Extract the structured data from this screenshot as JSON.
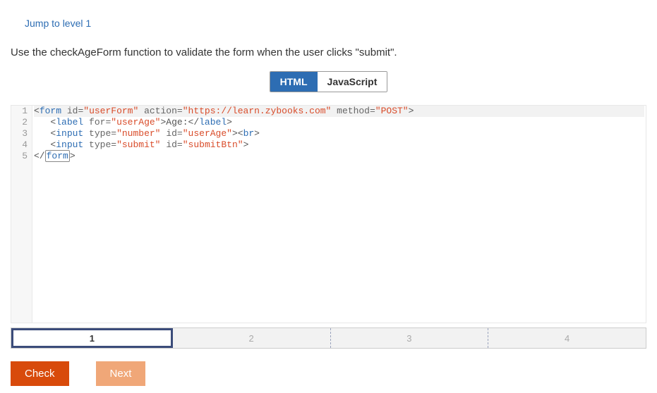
{
  "jump_link": "Jump to level 1",
  "instructions": "Use the checkAgeForm function to validate the form when the user clicks \"submit\".",
  "tabs": {
    "html": "HTML",
    "js": "JavaScript",
    "active": "html"
  },
  "code": {
    "lines": [
      {
        "n": "1",
        "tokens": [
          {
            "cls": "tag-bracket",
            "t": "<"
          },
          {
            "cls": "tag-name",
            "t": "form"
          },
          {
            "cls": "",
            "t": " "
          },
          {
            "cls": "attr-name",
            "t": "id"
          },
          {
            "cls": "equals",
            "t": "="
          },
          {
            "cls": "string",
            "t": "\"userForm\""
          },
          {
            "cls": "",
            "t": " "
          },
          {
            "cls": "attr-name",
            "t": "action"
          },
          {
            "cls": "equals",
            "t": "="
          },
          {
            "cls": "string",
            "t": "\"https://learn.zybooks.com\""
          },
          {
            "cls": "",
            "t": " "
          },
          {
            "cls": "attr-name",
            "t": "method"
          },
          {
            "cls": "equals",
            "t": "="
          },
          {
            "cls": "string",
            "t": "\"POST\""
          },
          {
            "cls": "tag-bracket",
            "t": ">"
          }
        ],
        "hl": true
      },
      {
        "n": "2",
        "tokens": [
          {
            "cls": "",
            "t": "   "
          },
          {
            "cls": "tag-bracket",
            "t": "<"
          },
          {
            "cls": "tag-name",
            "t": "label"
          },
          {
            "cls": "",
            "t": " "
          },
          {
            "cls": "attr-name",
            "t": "for"
          },
          {
            "cls": "equals",
            "t": "="
          },
          {
            "cls": "string",
            "t": "\"userAge\""
          },
          {
            "cls": "tag-bracket",
            "t": ">"
          },
          {
            "cls": "text",
            "t": "Age:"
          },
          {
            "cls": "tag-bracket",
            "t": "</"
          },
          {
            "cls": "tag-name",
            "t": "label"
          },
          {
            "cls": "tag-bracket",
            "t": ">"
          }
        ]
      },
      {
        "n": "3",
        "tokens": [
          {
            "cls": "",
            "t": "   "
          },
          {
            "cls": "tag-bracket",
            "t": "<"
          },
          {
            "cls": "tag-name",
            "t": "input"
          },
          {
            "cls": "",
            "t": " "
          },
          {
            "cls": "attr-name",
            "t": "type"
          },
          {
            "cls": "equals",
            "t": "="
          },
          {
            "cls": "string",
            "t": "\"number\""
          },
          {
            "cls": "",
            "t": " "
          },
          {
            "cls": "attr-name",
            "t": "id"
          },
          {
            "cls": "equals",
            "t": "="
          },
          {
            "cls": "string",
            "t": "\"userAge\""
          },
          {
            "cls": "tag-bracket",
            "t": "><"
          },
          {
            "cls": "tag-name",
            "t": "br"
          },
          {
            "cls": "tag-bracket",
            "t": ">"
          }
        ]
      },
      {
        "n": "4",
        "tokens": [
          {
            "cls": "",
            "t": "   "
          },
          {
            "cls": "tag-bracket",
            "t": "<"
          },
          {
            "cls": "tag-name",
            "t": "input"
          },
          {
            "cls": "",
            "t": " "
          },
          {
            "cls": "attr-name",
            "t": "type"
          },
          {
            "cls": "equals",
            "t": "="
          },
          {
            "cls": "string",
            "t": "\"submit\""
          },
          {
            "cls": "",
            "t": " "
          },
          {
            "cls": "attr-name",
            "t": "id"
          },
          {
            "cls": "equals",
            "t": "="
          },
          {
            "cls": "string",
            "t": "\"submitBtn\""
          },
          {
            "cls": "tag-bracket",
            "t": ">"
          }
        ]
      },
      {
        "n": "5",
        "tokens": [
          {
            "cls": "tag-bracket",
            "t": "</"
          },
          {
            "cls": "tag-name cursor-mark",
            "t": "form"
          },
          {
            "cls": "tag-bracket",
            "t": ">"
          }
        ]
      }
    ]
  },
  "progress": {
    "cells": [
      {
        "label": "1",
        "active": true
      },
      {
        "label": "2",
        "active": false
      },
      {
        "label": "3",
        "active": false
      },
      {
        "label": "4",
        "active": false
      }
    ]
  },
  "buttons": {
    "check": "Check",
    "next": "Next"
  }
}
